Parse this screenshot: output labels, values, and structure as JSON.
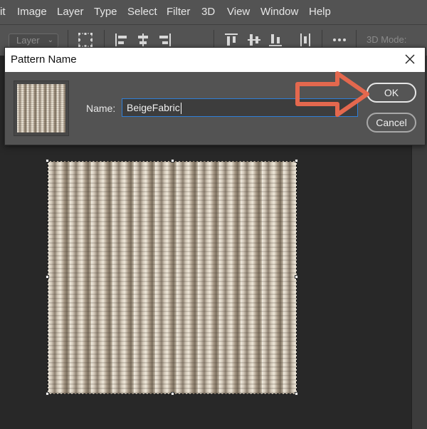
{
  "menubar": {
    "items": [
      "it",
      "Image",
      "Layer",
      "Type",
      "Select",
      "Filter",
      "3D",
      "View",
      "Window",
      "Help"
    ]
  },
  "options_bar": {
    "layer_select_value": "Layer",
    "three_d_mode_label": "3D Mode:"
  },
  "dialog": {
    "title": "Pattern Name",
    "name_label": "Name:",
    "name_value": "BeigeFabric",
    "ok_label": "OK",
    "cancel_label": "Cancel"
  },
  "colors": {
    "annotation_arrow": "#e4684e",
    "input_focus": "#2f7fd8"
  }
}
